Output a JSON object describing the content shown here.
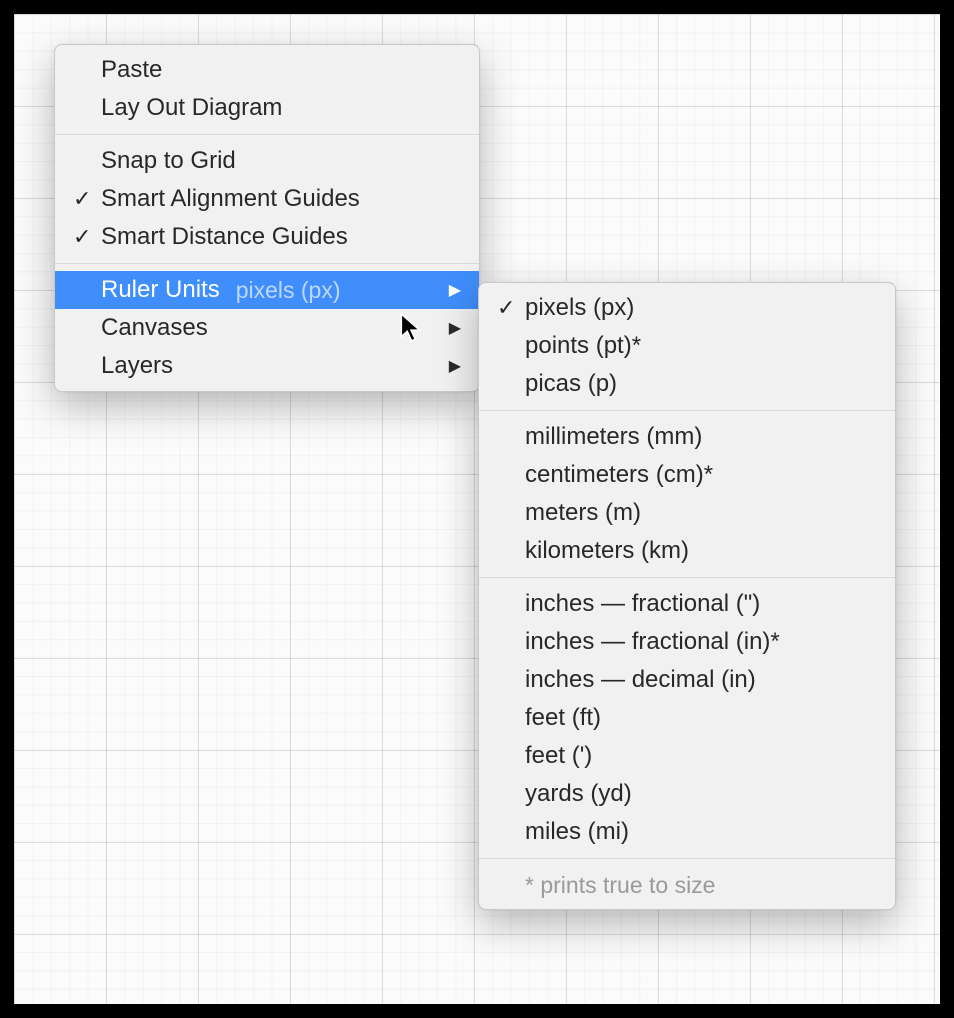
{
  "context_menu": {
    "groups": [
      {
        "items": [
          {
            "label": "Paste",
            "checked": false,
            "has_submenu": false,
            "highlighted": false,
            "name": "menu-paste"
          },
          {
            "label": "Lay Out Diagram",
            "checked": false,
            "has_submenu": false,
            "highlighted": false,
            "name": "menu-lay-out-diagram"
          }
        ]
      },
      {
        "items": [
          {
            "label": "Snap to Grid",
            "checked": false,
            "has_submenu": false,
            "highlighted": false,
            "name": "menu-snap-to-grid"
          },
          {
            "label": "Smart Alignment Guides",
            "checked": true,
            "has_submenu": false,
            "highlighted": false,
            "name": "menu-smart-alignment-guides"
          },
          {
            "label": "Smart Distance Guides",
            "checked": true,
            "has_submenu": false,
            "highlighted": false,
            "name": "menu-smart-distance-guides"
          }
        ]
      },
      {
        "items": [
          {
            "label": "Ruler Units",
            "value": "pixels (px)",
            "checked": false,
            "has_submenu": true,
            "highlighted": true,
            "name": "menu-ruler-units"
          },
          {
            "label": "Canvases",
            "checked": false,
            "has_submenu": true,
            "highlighted": false,
            "name": "menu-canvases"
          },
          {
            "label": "Layers",
            "checked": false,
            "has_submenu": true,
            "highlighted": false,
            "name": "menu-layers"
          }
        ]
      }
    ]
  },
  "ruler_units_submenu": {
    "groups": [
      {
        "items": [
          {
            "label": "pixels (px)",
            "checked": true,
            "name": "unit-pixels"
          },
          {
            "label": "points (pt)*",
            "checked": false,
            "name": "unit-points"
          },
          {
            "label": "picas (p)",
            "checked": false,
            "name": "unit-picas"
          }
        ]
      },
      {
        "items": [
          {
            "label": "millimeters (mm)",
            "checked": false,
            "name": "unit-millimeters"
          },
          {
            "label": "centimeters (cm)*",
            "checked": false,
            "name": "unit-centimeters"
          },
          {
            "label": "meters (m)",
            "checked": false,
            "name": "unit-meters"
          },
          {
            "label": "kilometers (km)",
            "checked": false,
            "name": "unit-kilometers"
          }
        ]
      },
      {
        "items": [
          {
            "label": "inches — fractional (\")",
            "checked": false,
            "name": "unit-inches-fractional-sym"
          },
          {
            "label": "inches — fractional (in)*",
            "checked": false,
            "name": "unit-inches-fractional-in"
          },
          {
            "label": "inches — decimal (in)",
            "checked": false,
            "name": "unit-inches-decimal"
          },
          {
            "label": "feet (ft)",
            "checked": false,
            "name": "unit-feet-ft"
          },
          {
            "label": "feet (')",
            "checked": false,
            "name": "unit-feet-sym"
          },
          {
            "label": "yards (yd)",
            "checked": false,
            "name": "unit-yards"
          },
          {
            "label": "miles (mi)",
            "checked": false,
            "name": "unit-miles"
          }
        ]
      }
    ],
    "footer_note": "* prints true to size"
  },
  "glyphs": {
    "check": "✓",
    "arrow": "▶"
  }
}
